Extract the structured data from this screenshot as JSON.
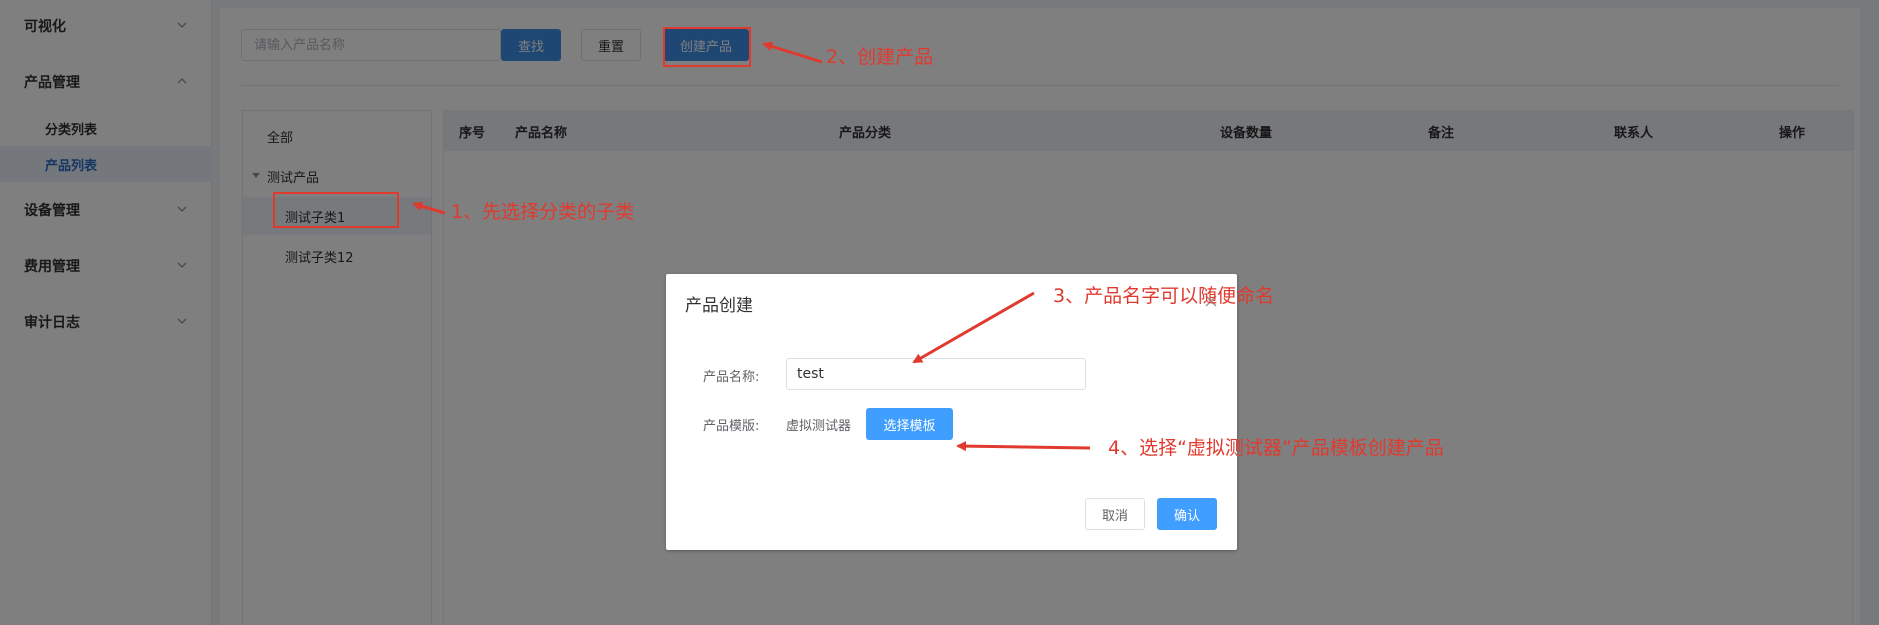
{
  "sidebar": {
    "groups": [
      {
        "label": "可视化",
        "expanded": false
      },
      {
        "label": "产品管理",
        "expanded": true
      },
      {
        "label": "设备管理",
        "expanded": false
      },
      {
        "label": "费用管理",
        "expanded": false
      },
      {
        "label": "审计日志",
        "expanded": false
      }
    ],
    "product_sub": [
      {
        "label": "分类列表",
        "active": false
      },
      {
        "label": "产品列表",
        "active": true
      }
    ]
  },
  "toolbar": {
    "search_placeholder": "请输入产品名称",
    "find_label": "查找",
    "reset_label": "重置",
    "create_label": "创建产品"
  },
  "tree": {
    "all_label": "全部",
    "category_label": "测试产品",
    "children": [
      {
        "label": "测试子类1",
        "selected": true
      },
      {
        "label": "测试子类12",
        "selected": false
      }
    ]
  },
  "table": {
    "columns": [
      "序号",
      "产品名称",
      "产品分类",
      "设备数量",
      "备注",
      "联系人",
      "操作"
    ]
  },
  "dialog": {
    "title": "产品创建",
    "name_label": "产品名称:",
    "name_value": "test",
    "template_label": "产品模版:",
    "template_value": "虚拟测试器",
    "select_template_label": "选择模板",
    "cancel_label": "取消",
    "confirm_label": "确认"
  },
  "annotations": {
    "step1": "1、先选择分类的子类",
    "step2": "2、创建产品",
    "step3": "3、产品名字可以随便命名",
    "step4": "4、选择“虚拟测试器”产品模板创建产品"
  },
  "colors": {
    "primary": "#409eff",
    "annotation": "#e03a2f",
    "active_menu": "#2a6ac4"
  }
}
